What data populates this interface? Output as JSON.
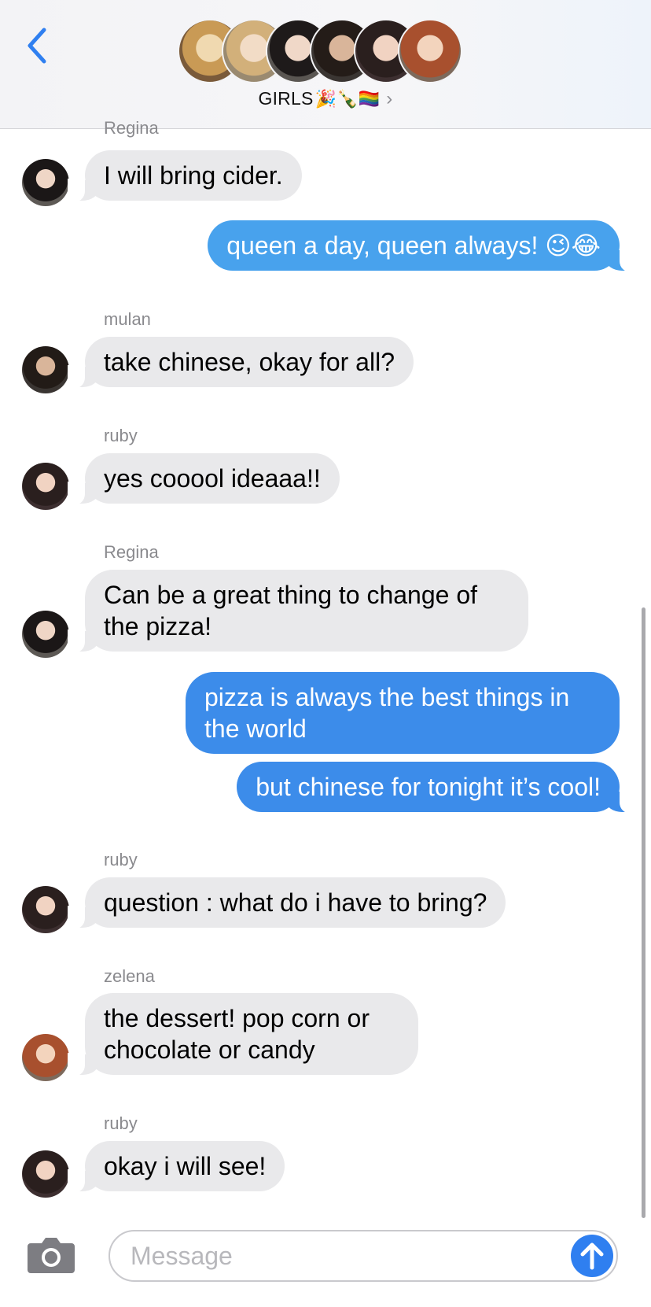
{
  "header": {
    "back_icon": "chevron-left-icon",
    "group_name": "GIRLS",
    "group_emojis": "🎉🍾🏳️‍🌈",
    "chevron": "›",
    "accent": "#2f7ff0"
  },
  "messages": [
    {
      "sender": "Regina",
      "text": "I will bring cider."
    },
    {
      "text": "queen a day, queen always! 😉😂"
    },
    {
      "sender": "mulan",
      "text": "take chinese, okay for all?"
    },
    {
      "sender": "ruby",
      "text": "yes cooool ideaaa!!"
    },
    {
      "sender": "Regina",
      "line1": "Can be a great thing to change of",
      "line2": "the pizza!"
    },
    {
      "line1": "pizza is always the best things in",
      "line2": "the world"
    },
    {
      "text": "but chinese for tonight it’s cool!"
    },
    {
      "sender": "ruby",
      "text": "question : what do i have to bring?"
    },
    {
      "sender": "zelena",
      "line1": "the dessert! pop corn or",
      "line2": "chocolate or candy"
    },
    {
      "sender": "ruby",
      "text": "okay i will see!"
    }
  ],
  "colors": {
    "incoming_bubble": "#e9e9eb",
    "outgoing_bubble": "#48a2ed",
    "send_button": "#2f7ff0"
  },
  "composer": {
    "camera_icon": "camera-icon",
    "placeholder": "Message",
    "send_icon": "arrow-up-icon"
  }
}
